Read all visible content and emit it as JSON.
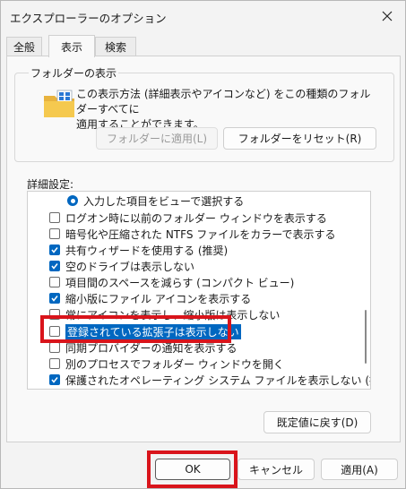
{
  "window": {
    "title": "エクスプローラーのオプション"
  },
  "tabs": [
    {
      "label": "全般",
      "active": false
    },
    {
      "label": "表示",
      "active": true
    },
    {
      "label": "検索",
      "active": false
    }
  ],
  "folder_view": {
    "group_label": "フォルダーの表示",
    "description_line1": "この表示方法 (詳細表示やアイコンなど) をこの種類のフォルダーすべてに",
    "description_line2": "適用することができます。",
    "apply_button": "フォルダーに適用(L)",
    "reset_button": "フォルダーをリセット(R)"
  },
  "advanced": {
    "label": "詳細設定:",
    "items": [
      {
        "type": "radio",
        "label": "入力した項目をビューで選択する",
        "checked": true
      },
      {
        "type": "checkbox",
        "label": "ログオン時に以前のフォルダー ウィンドウを表示する",
        "checked": false
      },
      {
        "type": "checkbox",
        "label": "暗号化や圧縮された NTFS ファイルをカラーで表示する",
        "checked": false
      },
      {
        "type": "checkbox",
        "label": "共有ウィザードを使用する (推奨)",
        "checked": true
      },
      {
        "type": "checkbox",
        "label": "空のドライブは表示しない",
        "checked": true
      },
      {
        "type": "checkbox",
        "label": "項目間のスペースを減らす (コンパクト ビュー)",
        "checked": false
      },
      {
        "type": "checkbox",
        "label": "縮小版にファイル アイコンを表示する",
        "checked": true
      },
      {
        "type": "checkbox",
        "label": "常にアイコンを表示し、縮小版は表示しない",
        "checked": false
      },
      {
        "type": "checkbox",
        "label": "登録されている拡張子は表示しない",
        "checked": false,
        "selected": true
      },
      {
        "type": "checkbox",
        "label": "同期プロバイダーの通知を表示する",
        "checked": false
      },
      {
        "type": "checkbox",
        "label": "別のプロセスでフォルダー ウィンドウを開く",
        "checked": false
      },
      {
        "type": "checkbox",
        "label": "保護されたオペレーティング システム ファイルを表示しない (推奨)",
        "checked": true
      }
    ],
    "restore_defaults_button": "既定値に戻す(D)"
  },
  "footer": {
    "ok_button": "OK",
    "cancel_button": "キャンセル",
    "apply_button": "適用(A)"
  },
  "colors": {
    "accent": "#0067c0",
    "highlight_box": "#d9141b"
  }
}
